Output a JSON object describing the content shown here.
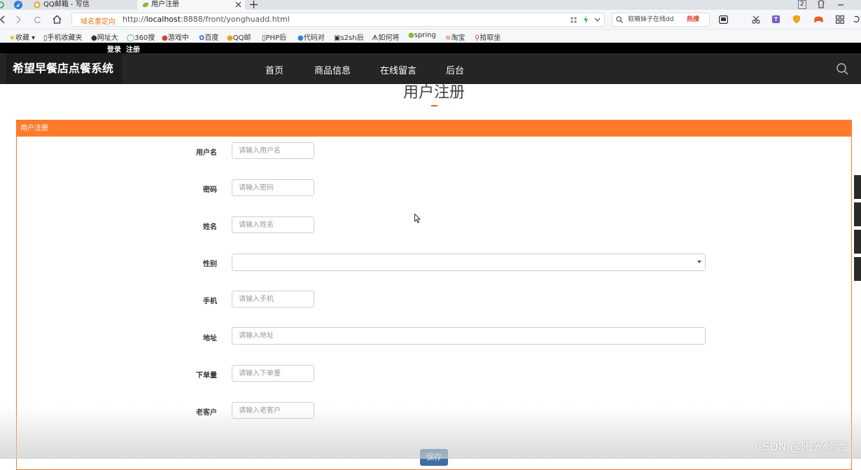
{
  "browser": {
    "tabs": [
      {
        "title": "QQ邮箱 - 写信"
      },
      {
        "title": "用户注册"
      }
    ],
    "redirect_label": "域名重定向",
    "url_prefix": "http://",
    "url_host": "localhost",
    "url_rest": ":8888/front/yonghuadd.html",
    "search_text": "软萌妹子在线dd",
    "hot_label": "热搜",
    "badge": "2",
    "bookmarks": [
      {
        "label": "收藏"
      },
      {
        "label": "手机收藏夹"
      },
      {
        "label": "网址大"
      },
      {
        "label": "360搜"
      },
      {
        "label": "游戏中"
      },
      {
        "label": "百度"
      },
      {
        "label": "QQ邮"
      },
      {
        "label": "PHP后"
      },
      {
        "label": "代码对"
      },
      {
        "label": "s2sh后"
      },
      {
        "label": "如何将"
      },
      {
        "label": "spring"
      },
      {
        "label": "淘宝"
      },
      {
        "label": "拾取坐"
      }
    ]
  },
  "site": {
    "top_links": {
      "login": "登录",
      "register": "注册"
    },
    "brand": "希望早餐店点餐系统",
    "nav": [
      {
        "label": "首页"
      },
      {
        "label": "商品信息"
      },
      {
        "label": "在线留言"
      },
      {
        "label": "后台"
      }
    ]
  },
  "page": {
    "title": "用户注册",
    "panel_title": "用户注册",
    "fields": [
      {
        "label": "用户名",
        "placeholder": "请输入用户名",
        "value": ""
      },
      {
        "label": "密码",
        "placeholder": "请输入密码",
        "value": ""
      },
      {
        "label": "姓名",
        "placeholder": "请输入姓名",
        "value": ""
      },
      {
        "label": "性别",
        "selected": ""
      },
      {
        "label": "手机",
        "placeholder": "请输入手机",
        "value": ""
      },
      {
        "label": "地址",
        "placeholder": "请输入地址",
        "value": ""
      },
      {
        "label": "下单量",
        "placeholder": "请输入下单量",
        "value": ""
      },
      {
        "label": "老客户",
        "placeholder": "请输入老客户",
        "value": ""
      }
    ],
    "save_label": "保存"
  },
  "watermark": "CSDN @阳光倾洒",
  "colors": {
    "accent": "#ff7a2b",
    "nav_bg": "#252525",
    "save_button": "#3d6fa5"
  }
}
